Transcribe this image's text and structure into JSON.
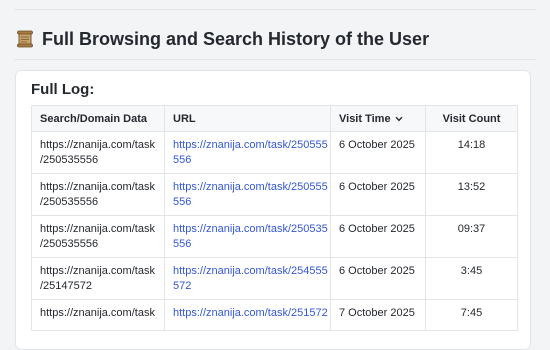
{
  "page": {
    "title": "Full Browsing and Search History of the User",
    "title_icon": "scroll-icon"
  },
  "log": {
    "heading": "Full Log:",
    "columns": {
      "data": "Search/Domain Data",
      "url": "URL",
      "time": "Visit Time",
      "count": "Visit Count"
    },
    "sort_icon": "chevron-down-icon",
    "rows": [
      {
        "data": [
          "https://znanija.com/task",
          "/250535556"
        ],
        "url": [
          "https://znanija.com/task/250555",
          "556"
        ],
        "time": "6 October 2025",
        "count": "14:18"
      },
      {
        "data": [
          "https://znanija.com/task",
          "/250535556"
        ],
        "url": [
          "https://znanija.com/task/250555",
          "556"
        ],
        "time": "6 October 2025",
        "count": "13:52"
      },
      {
        "data": [
          "https://znanija.com/task",
          "/250535556"
        ],
        "url": [
          "https://znanija.com/task/250535",
          "556"
        ],
        "time": "6 October 2025",
        "count": "09:37"
      },
      {
        "data": [
          "https://znanija.com/task",
          "/25147572"
        ],
        "url": [
          "https://znanija.com/task/254555",
          "572"
        ],
        "time": "6 October 2025",
        "count": "3:45"
      },
      {
        "data": [
          "https://znanija.com/task"
        ],
        "url": [
          "https://znanija.com/task/251572"
        ],
        "time": "7 October 2025",
        "count": "7:45"
      }
    ]
  },
  "colors": {
    "link": "#3457d5",
    "header_bg": "#f6f8fa",
    "border": "#e1e4e8"
  }
}
